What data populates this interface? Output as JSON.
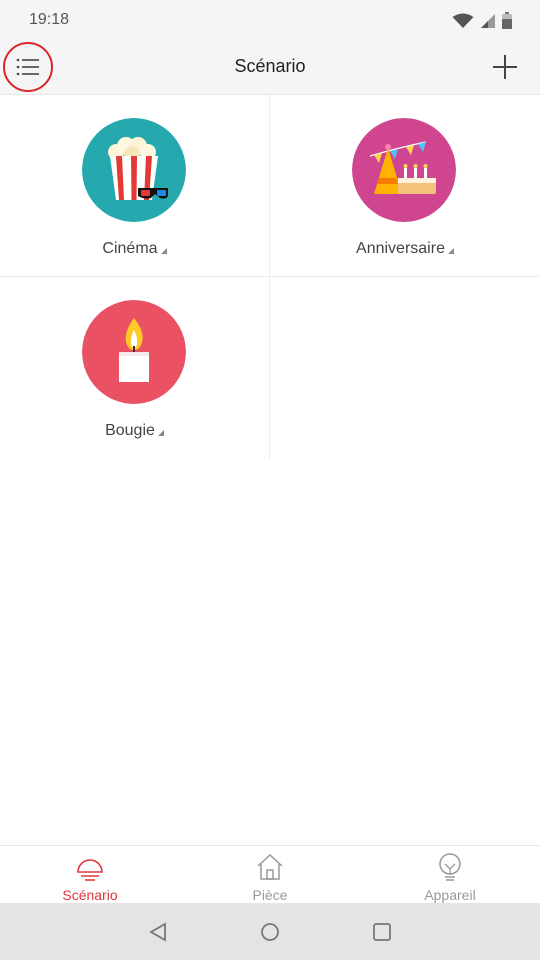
{
  "status_bar": {
    "time": "19:18",
    "icons": [
      "wifi-icon",
      "signal-icon",
      "battery-icon"
    ]
  },
  "header": {
    "title": "Scénario",
    "menu_icon": "menu-icon",
    "add_icon": "plus-icon"
  },
  "scenarios": [
    {
      "label": "Cinéma",
      "icon": "popcorn-icon",
      "color": "#26a9ae"
    },
    {
      "label": "Anniversaire",
      "icon": "party-icon",
      "color": "#cf4590"
    },
    {
      "label": "Bougie",
      "icon": "candle-icon",
      "color": "#ea5163"
    }
  ],
  "bottom_nav": {
    "active_color": "#e0383e",
    "inactive_color": "#999999",
    "items": [
      {
        "label": "Scénario",
        "icon": "scenario-icon",
        "active": true
      },
      {
        "label": "Pièce",
        "icon": "house-icon",
        "active": false
      },
      {
        "label": "Appareil",
        "icon": "bulb-icon",
        "active": false
      }
    ]
  },
  "system_nav": {
    "icons": [
      "back-icon",
      "home-icon",
      "recents-icon"
    ]
  }
}
